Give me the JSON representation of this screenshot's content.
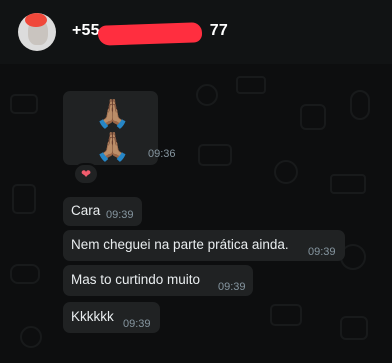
{
  "contact": {
    "name": "+55",
    "name_tail": "77"
  },
  "messages": [
    {
      "text": "🙏🏽🙏🏽",
      "time": "09:36"
    },
    {
      "text": "Cara",
      "time": "09:39"
    },
    {
      "text": "Nem cheguei na parte prática ainda.",
      "time": "09:39"
    },
    {
      "text": "Mas to curtindo muito",
      "time": "09:39"
    },
    {
      "text": "Kkkkkk",
      "time": "09:39"
    }
  ],
  "reaction": {
    "emoji": "❤"
  }
}
